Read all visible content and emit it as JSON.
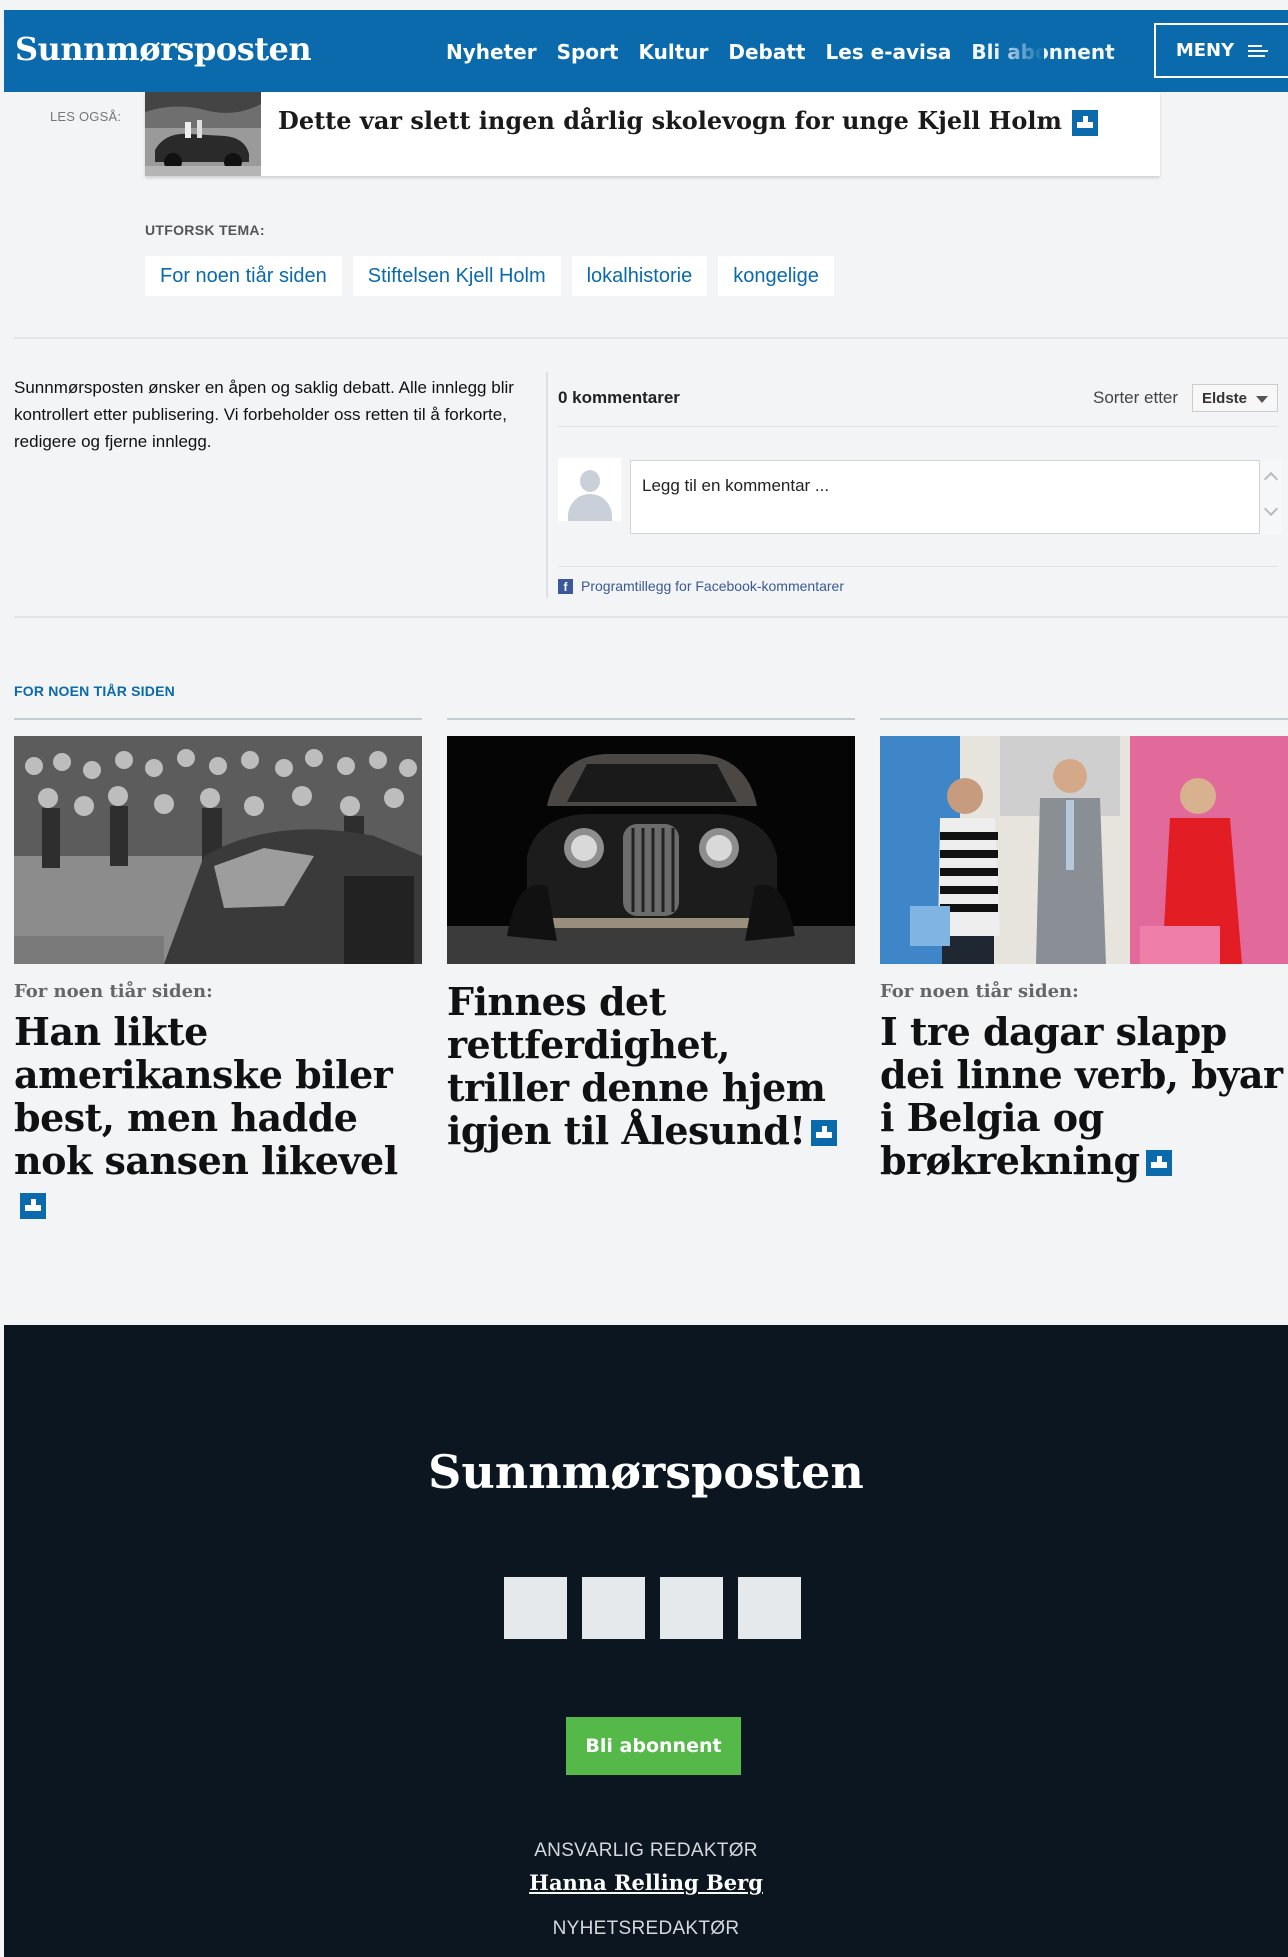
{
  "header": {
    "logo": "Sunnmørsposten",
    "nav": [
      "Nyheter",
      "Sport",
      "Kultur",
      "Debatt",
      "Les e-avisa",
      "Bli abonnent"
    ],
    "menu_label": "MENY",
    "colors": {
      "brand": "#0a6aab"
    }
  },
  "les_ogsa": {
    "label": "LES OGSÅ:",
    "title": "Dette var slett ingen dårlig skolevogn for unge Kjell Holm",
    "plus_icon": "plus-subscription-icon"
  },
  "utforsk": {
    "heading": "UTFORSK TEMA:",
    "tags": [
      "For noen tiår siden",
      "Stiftelsen Kjell Holm",
      "lokalhistorie",
      "kongelige"
    ]
  },
  "debate": {
    "text": "Sunnmørsposten ønsker en åpen og saklig debatt. Alle innlegg blir kontrollert etter publisering. Vi forbeholder oss retten til å forkorte, redigere og fjerne innlegg.",
    "comment_count": "0 kommentarer",
    "sort_label": "Sorter etter",
    "sort_value": "Eldste",
    "input_placeholder": "Legg til en kommentar ...",
    "fb_plugin": "Programtillegg for Facebook-kommentarer"
  },
  "section": {
    "heading": "FOR NOEN TIÅR SIDEN",
    "cards": [
      {
        "kicker": "For noen tiår siden:",
        "headline": "Han likte amerikanske biler best, men hadde nok sansen likevel"
      },
      {
        "kicker": "",
        "headline": "Finnes det rettferdighet, triller denne hjem igjen til Ålesund!"
      },
      {
        "kicker": "For noen tiår siden:",
        "headline": "I tre dagar slapp dei linne verb, byar i Belgia og brøkrekning"
      }
    ]
  },
  "footer": {
    "logo": "Sunnmørsposten",
    "subscribe": "Bli abonnent",
    "role1": "ANSVARLIG REDAKTØR",
    "name1": "Hanna Relling Berg",
    "role2": "NYHETSREDAKTØR",
    "colors": {
      "bg": "#0b1620",
      "button": "#54b948"
    }
  }
}
